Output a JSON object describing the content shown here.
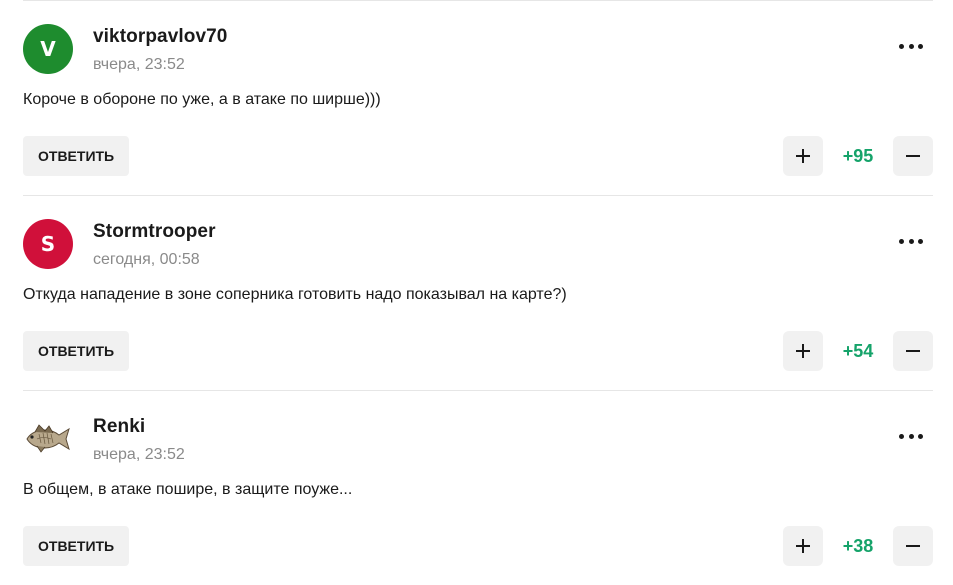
{
  "comments": [
    {
      "avatar_letter": "V",
      "avatar_color": "#1e8c2e",
      "author": "viktorpavlov70",
      "time": "вчера, 23:52",
      "text": "Короче в обороне по уже, а в атаке по ширше)))",
      "reply_label": "ОТВЕТИТЬ",
      "score": "+95"
    },
    {
      "avatar_letter": "S",
      "avatar_color": "#d0103a",
      "author": "Stormtrooper",
      "time": "сегодня, 00:58",
      "text": "Откуда нападение в зоне соперника готовить надо показывал на карте?)",
      "reply_label": "ОТВЕТИТЬ",
      "score": "+54"
    },
    {
      "avatar_icon": "fish-icon",
      "author": "Renki",
      "time": "вчера, 23:52",
      "text": "В общем, в атаке пошире, в защите поуже...",
      "reply_label": "ОТВЕТИТЬ",
      "score": "+38"
    }
  ],
  "colors": {
    "score_positive": "#15a36a",
    "button_bg": "#f1f1f1",
    "divider": "#e6e6e6",
    "meta_text": "#8a8a8a"
  }
}
